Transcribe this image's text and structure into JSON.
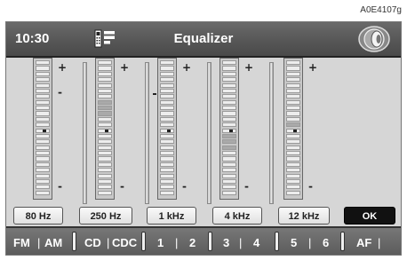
{
  "reference_code": "A0E4107g",
  "header": {
    "time": "10:30",
    "title": "Equalizer",
    "phone_icon": "phone-menu-icon",
    "speaker_icon": "speaker-icon"
  },
  "bands": [
    {
      "label": "80 Hz",
      "level_marker": 0.25
    },
    {
      "label": "250 Hz",
      "level_marker": null
    },
    {
      "label": "1 kHz",
      "level_marker": 0.22
    },
    {
      "label": "4 kHz",
      "level_marker": null
    },
    {
      "label": "12 kHz",
      "level_marker": null
    }
  ],
  "ok_label": "OK",
  "plus_symbol": "+",
  "minus_symbol": "-",
  "sources": [
    "FM",
    "AM",
    "CD",
    "CDC",
    "1",
    "2",
    "3",
    "4",
    "5",
    "6",
    "AF"
  ]
}
